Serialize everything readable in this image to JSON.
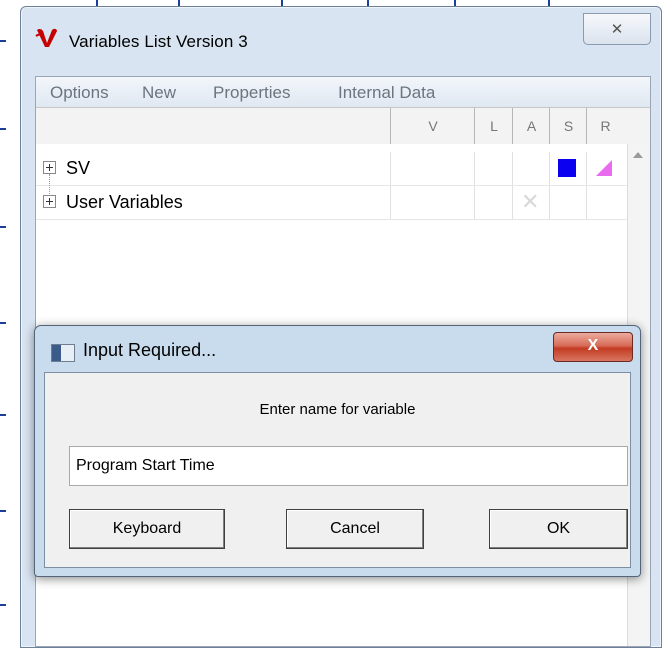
{
  "window": {
    "title": "Variables List Version 3",
    "close_glyph": "✕"
  },
  "menu": {
    "items": [
      "Options",
      "New",
      "Properties",
      "Internal Data"
    ]
  },
  "columns": [
    "V",
    "L",
    "A",
    "S",
    "R"
  ],
  "tree": [
    {
      "label": "SV",
      "expander": "+",
      "s_color": "#0b00f0",
      "r_color": "#e86bf0"
    },
    {
      "label": "User Variables",
      "expander": "+"
    }
  ],
  "dialog": {
    "title": "Input Required...",
    "close_glyph": "X",
    "prompt": "Enter name for variable",
    "input_value": "Program Start Time",
    "buttons": {
      "keyboard": "Keyboard",
      "cancel": "Cancel",
      "ok": "OK"
    }
  },
  "icons": {
    "app_logo": "v-logo-icon",
    "dialog_icon": "window-icon",
    "x_marker": "cross-icon"
  },
  "colors": {
    "blue_swatch": "#0b00f0",
    "pink_swatch": "#e86bf0",
    "close_red": "#c23b22"
  }
}
